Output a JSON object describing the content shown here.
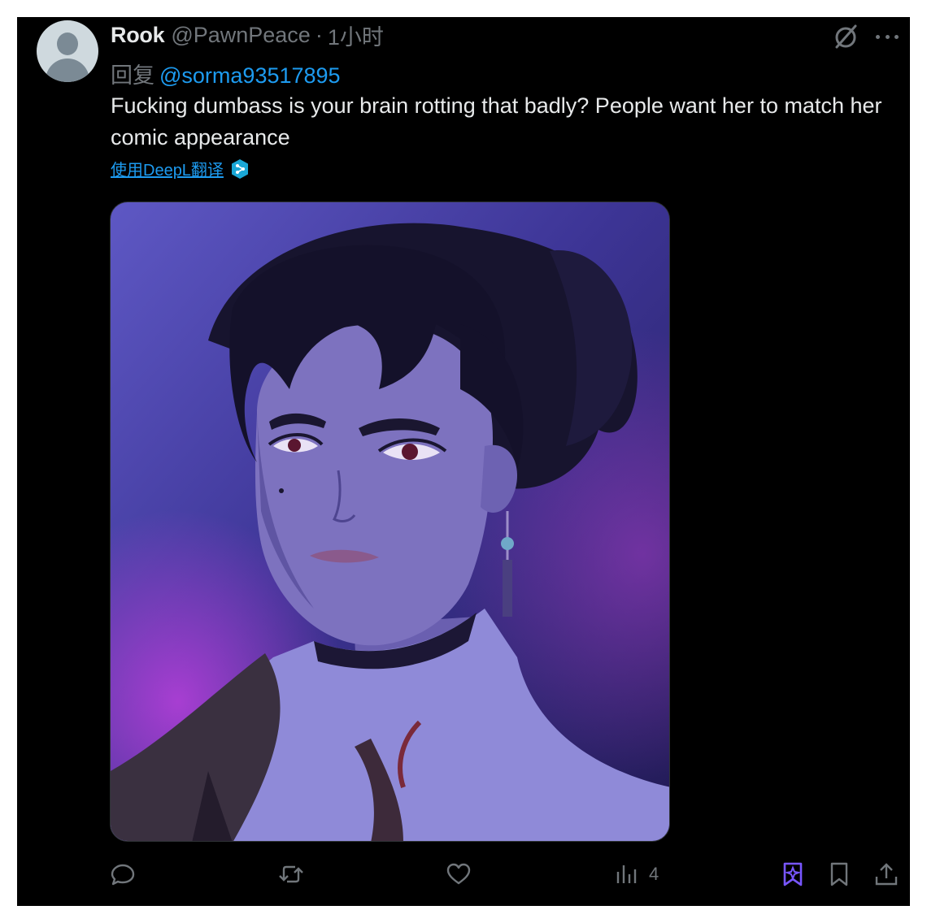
{
  "tweet": {
    "author_name": "Rook",
    "author_handle": "@PawnPeace",
    "separator": "·",
    "time_ago": "1小时",
    "reply_label": "回复",
    "reply_to": "@sorma93517895",
    "text": "Fucking dumbass is your brain rotting that badly? People want her to match her comic appearance",
    "translate_link": "使用DeepL翻译"
  },
  "actions": {
    "views_count": "4"
  },
  "icons": {
    "avatar": "default-avatar-icon",
    "grok": "grok-icon",
    "more": "more-icon",
    "deepl": "deepl-icon",
    "reply": "reply-icon",
    "retweet": "retweet-icon",
    "like": "heart-icon",
    "views": "analytics-icon",
    "grok_bookmark": "grok-explain-icon",
    "bookmark": "bookmark-icon",
    "share": "share-icon"
  },
  "colors": {
    "background": "#000000",
    "primary_text": "#e7e9ea",
    "secondary_text": "#71767b",
    "link": "#1d9bf0",
    "accent_purple": "#7856ff"
  }
}
